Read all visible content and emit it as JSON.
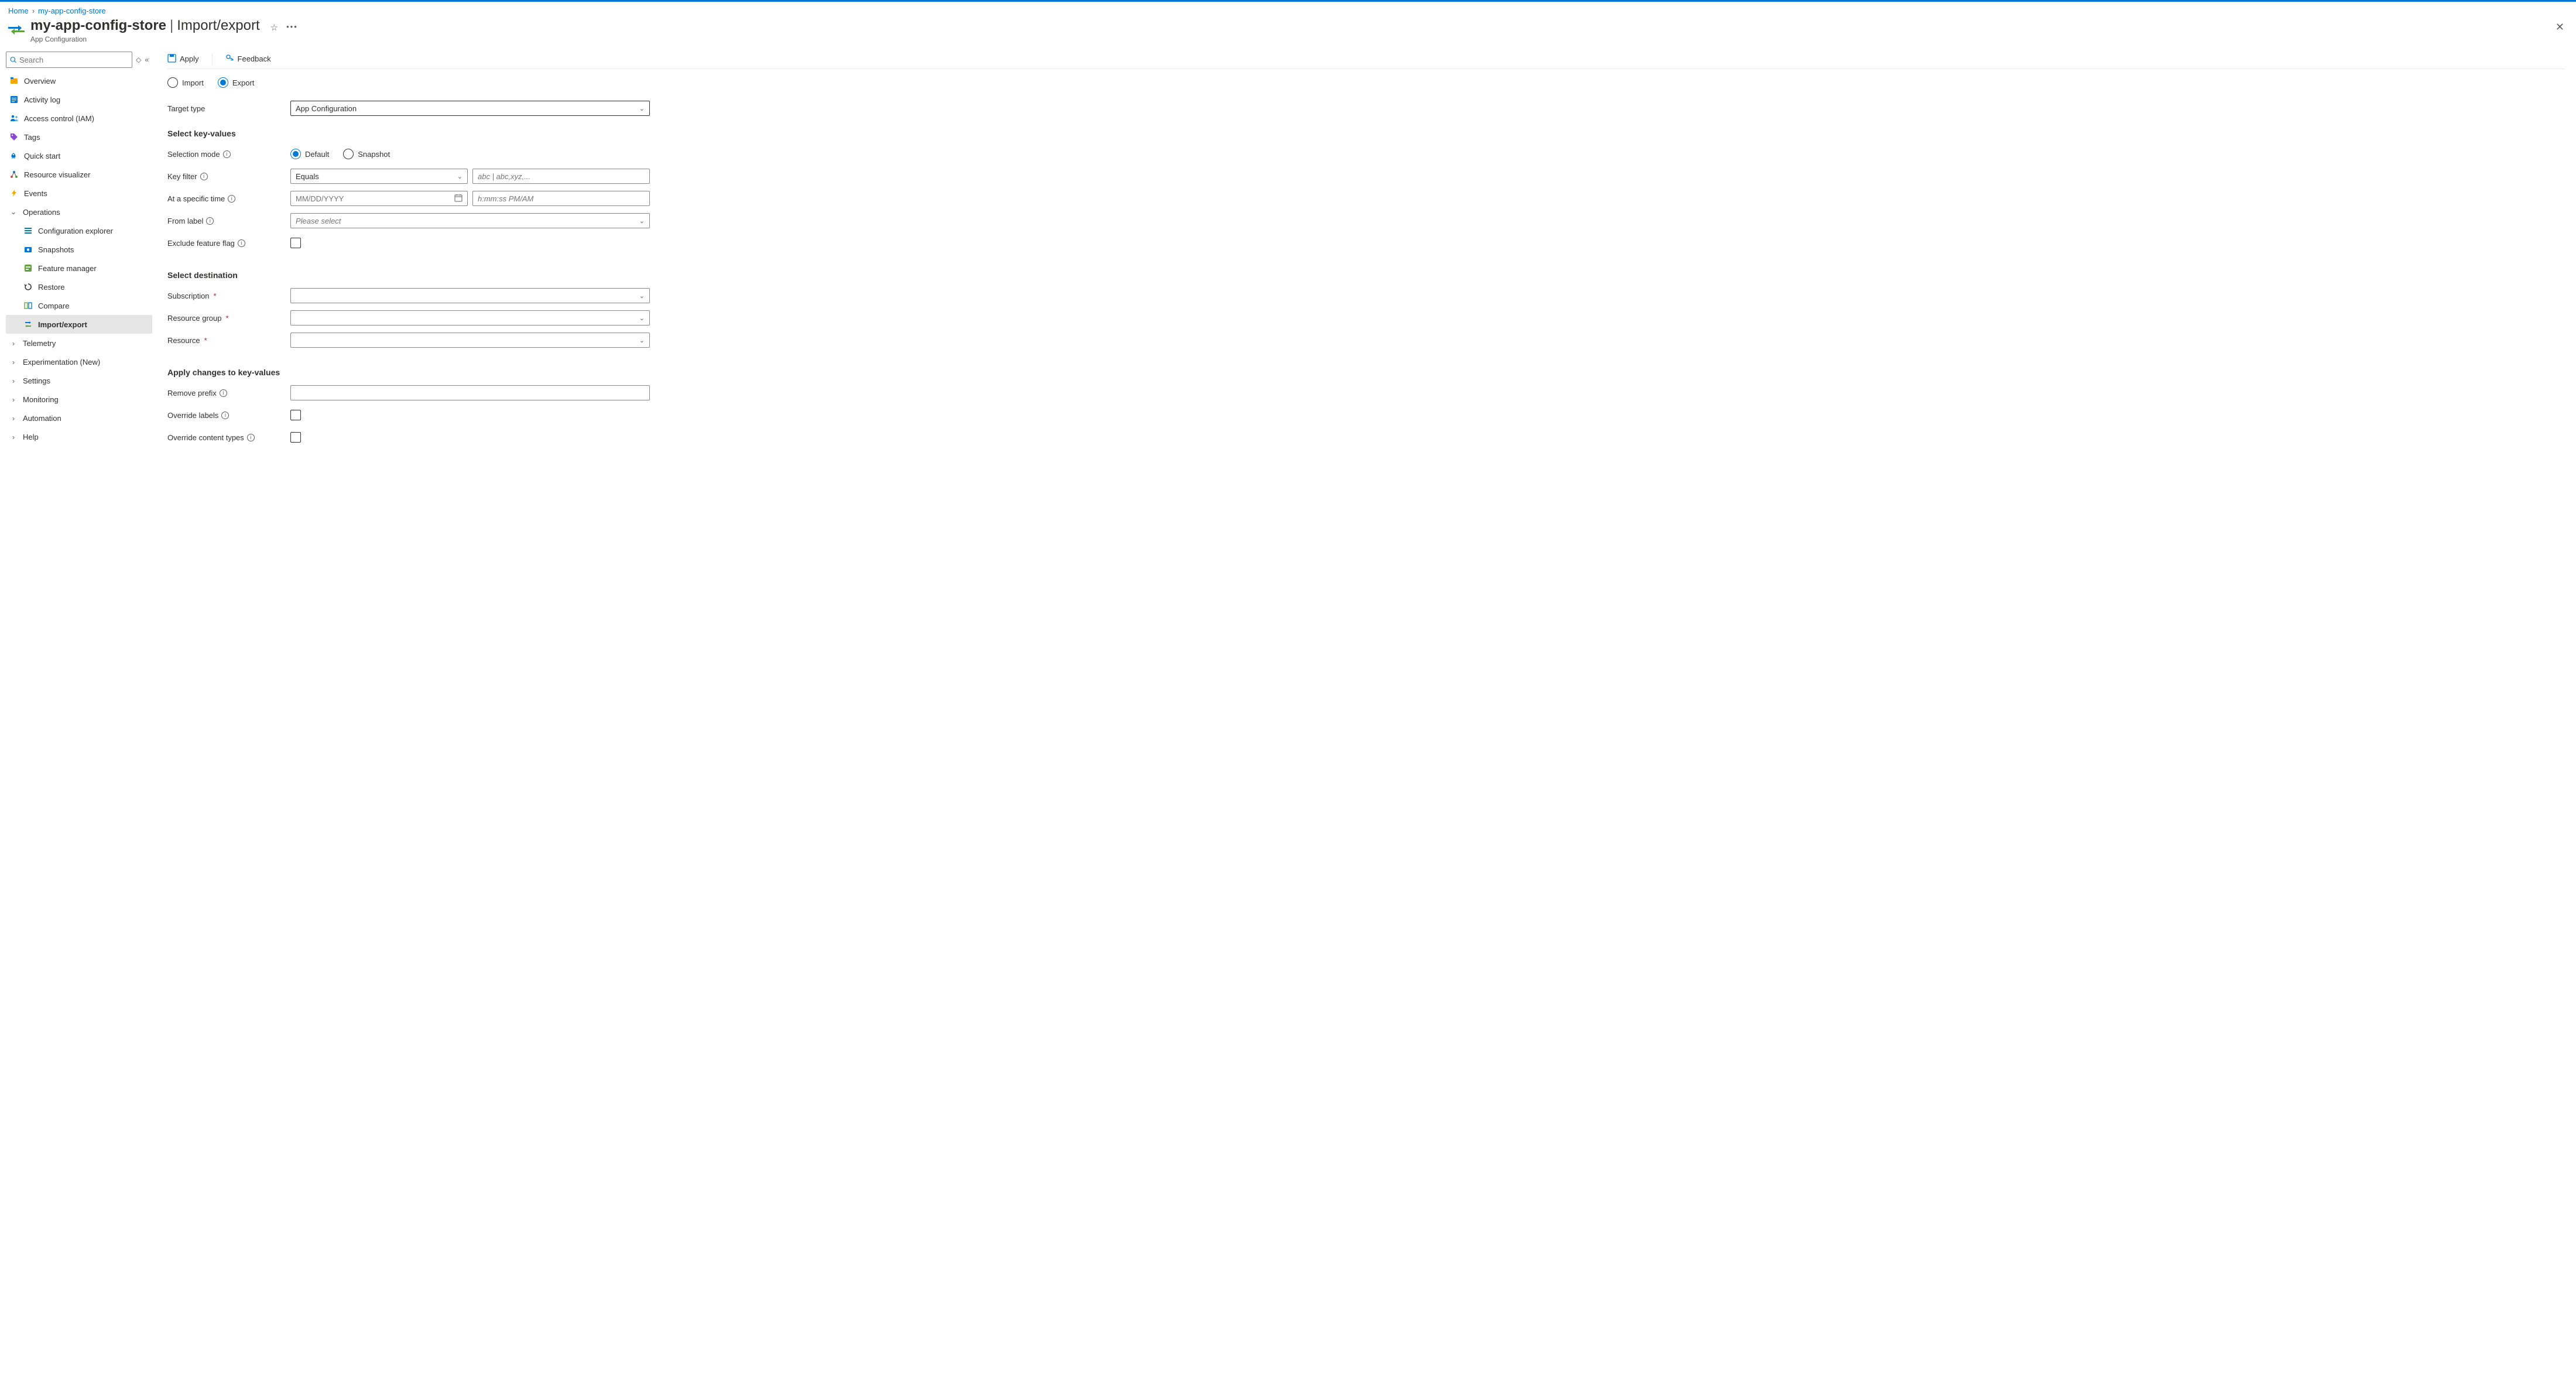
{
  "breadcrumb": {
    "home": "Home",
    "store": "my-app-config-store"
  },
  "header": {
    "title": "my-app-config-store",
    "section": "Import/export",
    "resourceType": "App Configuration"
  },
  "sidebar": {
    "searchPlaceholder": "Search",
    "items": {
      "overview": "Overview",
      "activity": "Activity log",
      "iam": "Access control (IAM)",
      "tags": "Tags",
      "quickstart": "Quick start",
      "visualizer": "Resource visualizer",
      "events": "Events",
      "operations": "Operations",
      "configExplorer": "Configuration explorer",
      "snapshots": "Snapshots",
      "featureManager": "Feature manager",
      "restore": "Restore",
      "compare": "Compare",
      "importExport": "Import/export",
      "telemetry": "Telemetry",
      "experimentation": "Experimentation (New)",
      "settings": "Settings",
      "monitoring": "Monitoring",
      "automation": "Automation",
      "help": "Help"
    }
  },
  "toolbar": {
    "apply": "Apply",
    "feedback": "Feedback"
  },
  "radios": {
    "import": "Import",
    "export": "Export"
  },
  "form": {
    "targetTypeLabel": "Target type",
    "targetTypeValue": "App Configuration",
    "section1": "Select key-values",
    "selectionMode": "Selection mode",
    "selDefault": "Default",
    "selSnapshot": "Snapshot",
    "keyFilter": "Key filter",
    "keyFilterValue": "Equals",
    "keyFilterPlaceholder": "abc | abc,xyz,...",
    "atTime": "At a specific time",
    "datePlaceholder": "MM/DD/YYYY",
    "timePlaceholder": "h:mm:ss PM/AM",
    "fromLabel": "From label",
    "fromLabelPlaceholder": "Please select",
    "excludeFF": "Exclude feature flag",
    "section2": "Select destination",
    "subscription": "Subscription",
    "resourceGroup": "Resource group",
    "resource": "Resource",
    "section3": "Apply changes to key-values",
    "removePrefix": "Remove prefix",
    "overrideLabels": "Override labels",
    "overrideCT": "Override content types"
  }
}
